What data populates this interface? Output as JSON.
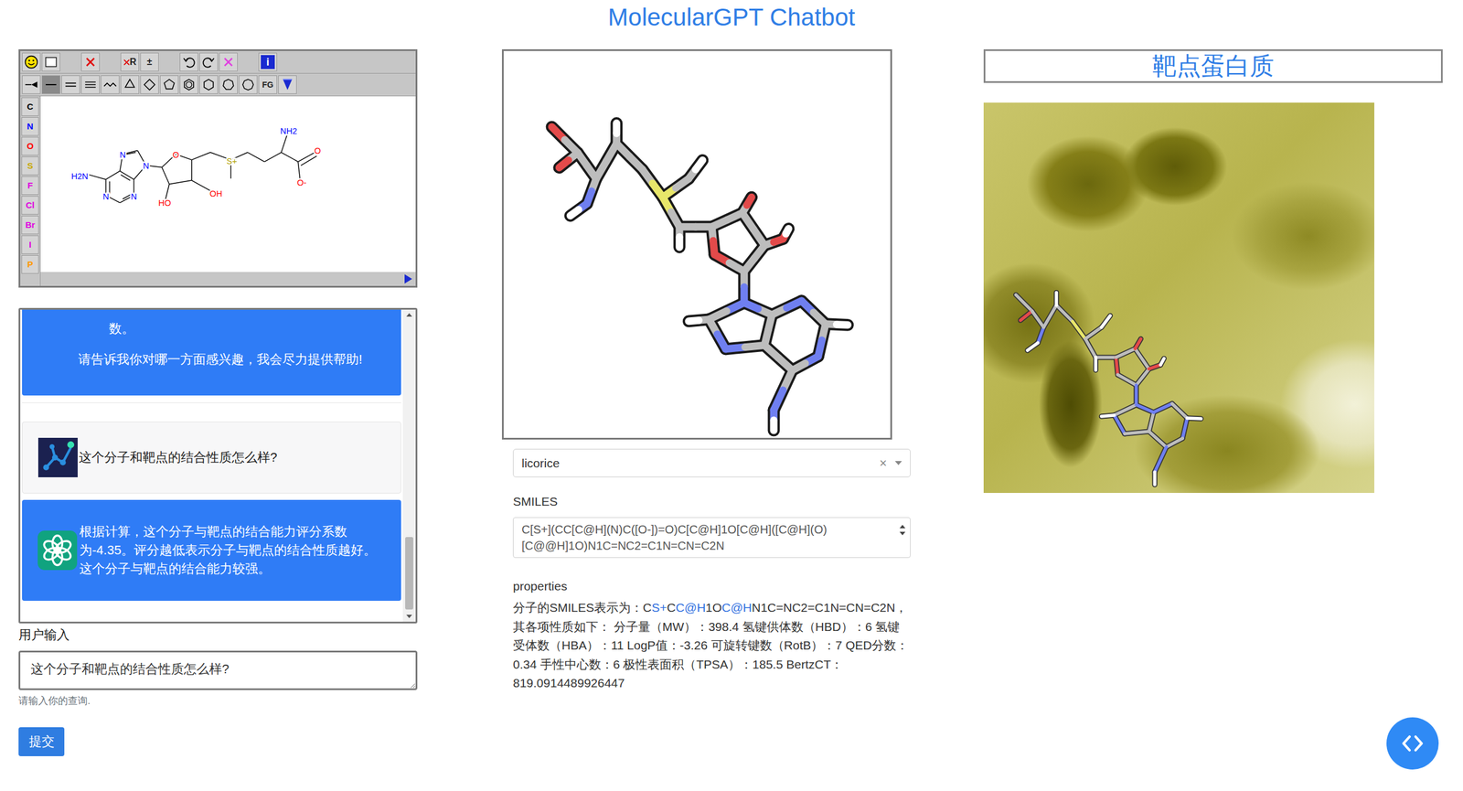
{
  "page": {
    "title": "MolecularGPT Chatbot"
  },
  "editor": {
    "toolbar_top": [
      {
        "kind": "smiley"
      },
      {
        "kind": "new"
      },
      {
        "kind": "blank"
      },
      {
        "kind": "delete"
      },
      {
        "kind": "blank"
      },
      {
        "kind": "delete-r",
        "text": "R"
      },
      {
        "kind": "charge",
        "text": "±"
      },
      {
        "kind": "blank"
      },
      {
        "kind": "undo"
      },
      {
        "kind": "redo"
      },
      {
        "kind": "clear"
      },
      {
        "kind": "blank"
      },
      {
        "kind": "info",
        "text": "i"
      }
    ],
    "toolbar_bottom": [
      {
        "kind": "stereo",
        "selected": false
      },
      {
        "kind": "single",
        "selected": true
      },
      {
        "kind": "double",
        "selected": false
      },
      {
        "kind": "triple",
        "selected": false
      },
      {
        "kind": "chain",
        "selected": false
      },
      {
        "kind": "ring3",
        "selected": false
      },
      {
        "kind": "ring4",
        "selected": false
      },
      {
        "kind": "ring5",
        "selected": false
      },
      {
        "kind": "benzene",
        "selected": false
      },
      {
        "kind": "ring6",
        "selected": false
      },
      {
        "kind": "ring7",
        "selected": false
      },
      {
        "kind": "ring8",
        "selected": false
      },
      {
        "kind": "fg",
        "text": "FG",
        "selected": false
      },
      {
        "kind": "template",
        "selected": false
      }
    ],
    "atoms": [
      {
        "label": "C",
        "color": "#000000"
      },
      {
        "label": "N",
        "color": "#0000ff"
      },
      {
        "label": "O",
        "color": "#ff0000"
      },
      {
        "label": "S",
        "color": "#c8a800"
      },
      {
        "label": "F",
        "color": "#e000e0"
      },
      {
        "label": "Cl",
        "color": "#e000e0"
      },
      {
        "label": "Br",
        "color": "#e000e0"
      },
      {
        "label": "I",
        "color": "#e000e0"
      },
      {
        "label": "P",
        "color": "#ff9900"
      }
    ],
    "molecule_labels": [
      {
        "text": "N",
        "color": "#0000ff"
      },
      {
        "text": "N",
        "color": "#0000ff"
      },
      {
        "text": "H2N",
        "color": "#0000ff"
      },
      {
        "text": "N",
        "color": "#0000ff"
      },
      {
        "text": "N",
        "color": "#0000ff"
      },
      {
        "text": "O",
        "color": "#ff0000"
      },
      {
        "text": "HO",
        "color": "#ff0000"
      },
      {
        "text": "OH",
        "color": "#ff0000"
      },
      {
        "text": "S+",
        "color": "#b0a000"
      },
      {
        "text": "NH2",
        "color": "#0000ff"
      },
      {
        "text": "O",
        "color": "#ff0000"
      },
      {
        "text": "O-",
        "color": "#ff0000"
      }
    ]
  },
  "chat": {
    "messages": [
      {
        "kind": "continued",
        "lines": [
          "数。",
          "请告诉我你对哪一方面感兴趣，我会尽力提供帮助!"
        ]
      },
      {
        "kind": "user",
        "text": "这个分子和靶点的结合性质怎么样?"
      },
      {
        "kind": "bot",
        "text": "根据计算，这个分子与靶点的结合能力评分系数为-4.35。评分越低表示分子与靶点的结合性质越好。这个分子与靶点的结合能力较强。"
      }
    ]
  },
  "input": {
    "label": "用户输入",
    "value": "这个分子和靶点的结合性质怎么样?",
    "hint": "请输入你的查询.",
    "submit": "提交"
  },
  "viewer": {
    "style": "licorice",
    "clear": "×"
  },
  "smiles": {
    "label": "SMILES",
    "value": "C[S+](CC[C@H](N)C([O-])=O)C[C@H]1O[C@H]([C@H](O)[C@@H]1O)N1C=NC2=C1N=CN=C2N"
  },
  "properties": {
    "label": "properties",
    "segments": [
      {
        "text": "分子的SMILES表示为：C",
        "blue": false
      },
      {
        "text": "S+",
        "blue": true
      },
      {
        "text": "C",
        "blue": false
      },
      {
        "text": "C@H",
        "blue": true
      },
      {
        "text": "1O",
        "blue": false
      },
      {
        "text": "C@H",
        "blue": true
      },
      {
        "text": "N1C=NC2=C1N=CN=C2N，其各项性质如下： 分子量（MW）：398.4 氢键供体数（HBD）：6 氢键受体数（HBA）：11 LogP值：-3.26 可旋转键数（RotB）：7 QED分数：0.34 手性中心数：6 极性表面积（TPSA）：185.5 BertzCT：819.0914489926447",
        "blue": false
      }
    ]
  },
  "target": {
    "title": "靶点蛋白质"
  }
}
